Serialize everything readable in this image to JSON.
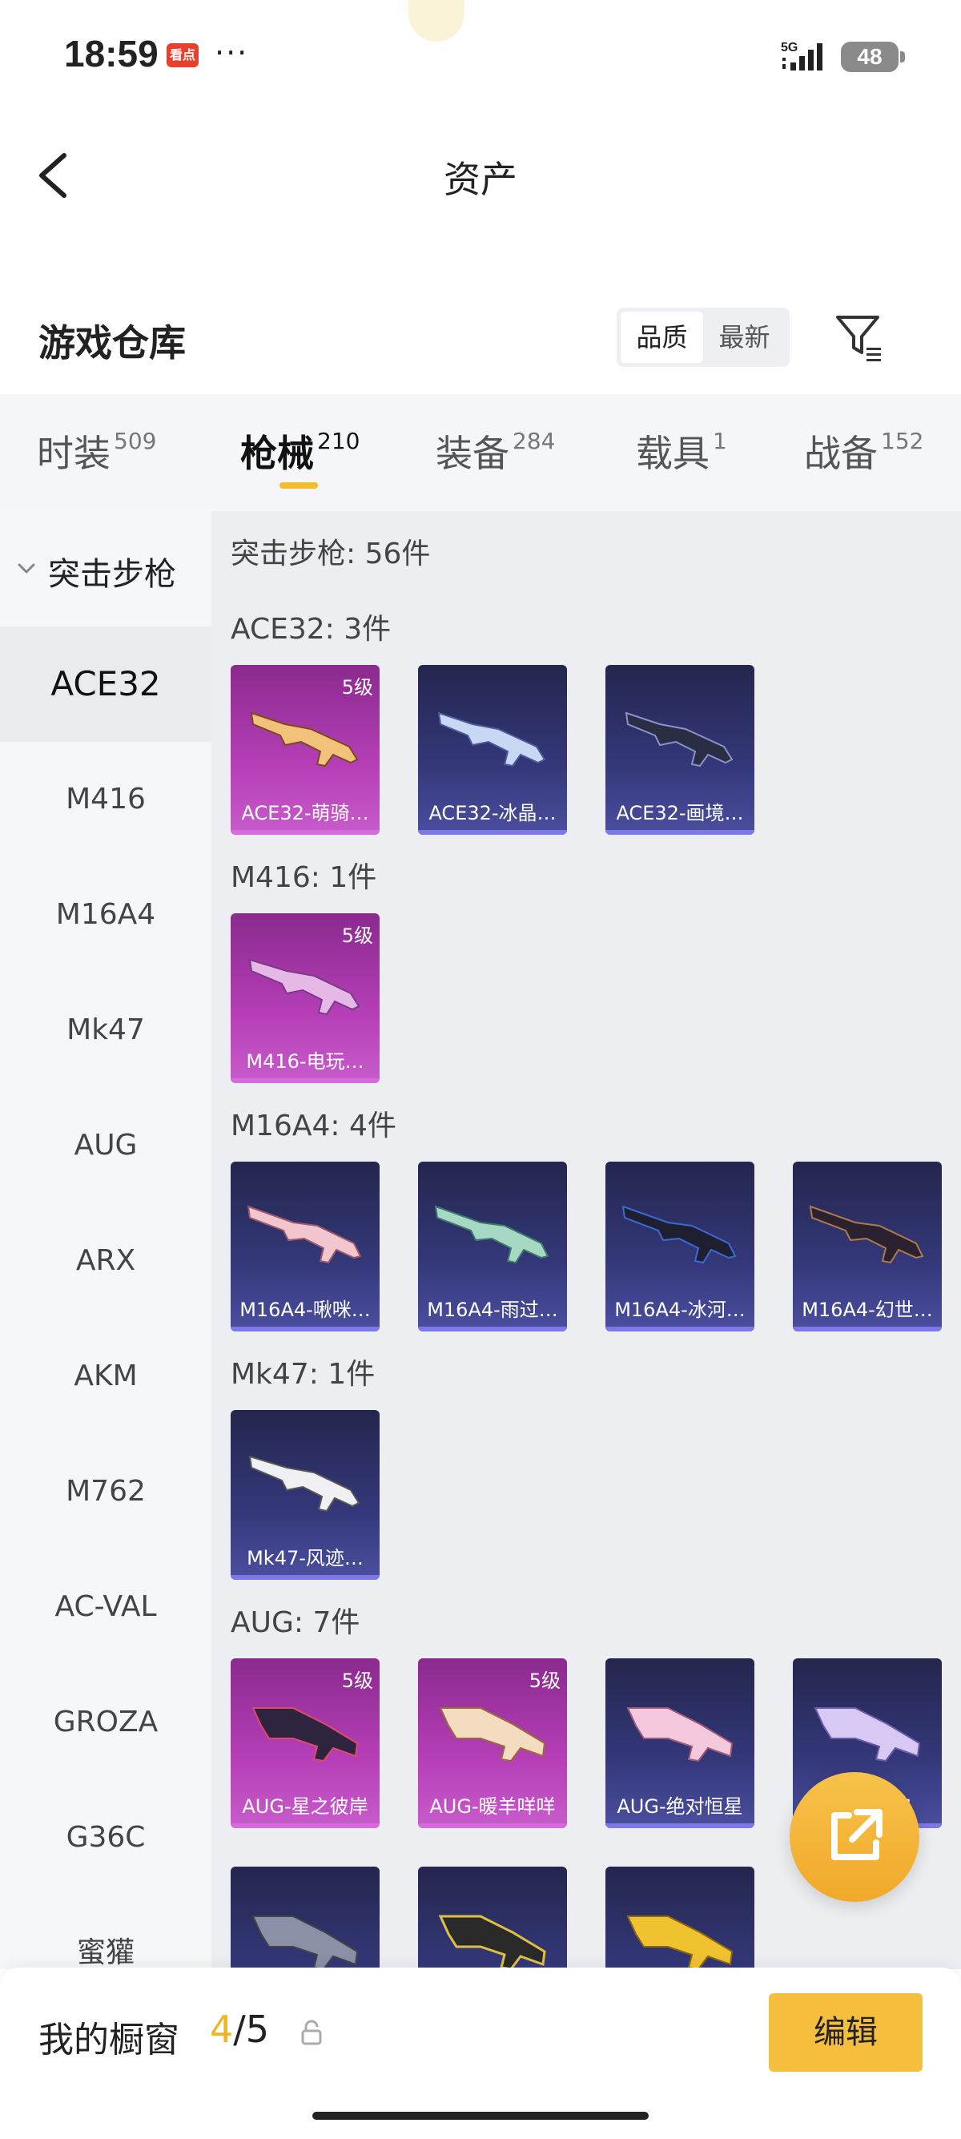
{
  "status_bar": {
    "time": "18:59",
    "app_badge": "看点",
    "dots": "···",
    "network": "5G",
    "battery": "48"
  },
  "header": {
    "title": "资产"
  },
  "warehouse": {
    "title": "游戏仓库",
    "sort_options": [
      "品质",
      "最新"
    ],
    "active_sort": "品质"
  },
  "tabs": [
    {
      "label": "时装",
      "count": "509"
    },
    {
      "label": "枪械",
      "count": "210"
    },
    {
      "label": "装备",
      "count": "284"
    },
    {
      "label": "载具",
      "count": "1"
    },
    {
      "label": "战备",
      "count": "152"
    }
  ],
  "active_tab": "枪械",
  "sidebar": {
    "group": "突击步枪",
    "items": [
      "ACE32",
      "M416",
      "M16A4",
      "Mk47",
      "AUG",
      "ARX",
      "AKM",
      "M762",
      "AC-VAL",
      "GROZA",
      "G36C",
      "蜜獾"
    ],
    "active": "ACE32"
  },
  "content": {
    "summary": "突击步枪: 56件",
    "sections": [
      {
        "label": "ACE32: 3件",
        "items": [
          {
            "name": "ACE32-萌骑…",
            "level": "5级",
            "rarity": "purple"
          },
          {
            "name": "ACE32-冰晶…",
            "level": "",
            "rarity": "blue"
          },
          {
            "name": "ACE32-画境…",
            "level": "",
            "rarity": "blue"
          }
        ]
      },
      {
        "label": "M416: 1件",
        "items": [
          {
            "name": "M416-电玩…",
            "level": "5级",
            "rarity": "purple"
          }
        ]
      },
      {
        "label": "M16A4: 4件",
        "items": [
          {
            "name": "M16A4-啾咪…",
            "level": "",
            "rarity": "blue"
          },
          {
            "name": "M16A4-雨过…",
            "level": "",
            "rarity": "blue"
          },
          {
            "name": "M16A4-冰河…",
            "level": "",
            "rarity": "blue"
          },
          {
            "name": "M16A4-幻世…",
            "level": "",
            "rarity": "blue"
          }
        ]
      },
      {
        "label": "Mk47: 1件",
        "items": [
          {
            "name": "Mk47-风迹…",
            "level": "",
            "rarity": "blue"
          }
        ]
      },
      {
        "label": "AUG: 7件",
        "items": [
          {
            "name": "AUG-星之彼岸",
            "level": "5级",
            "rarity": "purple"
          },
          {
            "name": "AUG-暖羊咩咩",
            "level": "5级",
            "rarity": "purple"
          },
          {
            "name": "AUG-绝对恒星",
            "level": "",
            "rarity": "blue"
          },
          {
            "name": "AUG-…宝",
            "level": "",
            "rarity": "blue"
          },
          {
            "name": "",
            "level": "",
            "rarity": "blue"
          },
          {
            "name": "",
            "level": "",
            "rarity": "blue"
          },
          {
            "name": "",
            "level": "",
            "rarity": "blue"
          }
        ]
      }
    ]
  },
  "bottom_bar": {
    "window_label": "我的橱窗",
    "current": "4",
    "total": "/5",
    "edit_label": "编辑"
  },
  "colors": {
    "accent": "#f4bd2b",
    "purple_card": "#b63fb7",
    "blue_card": "#34387a"
  }
}
